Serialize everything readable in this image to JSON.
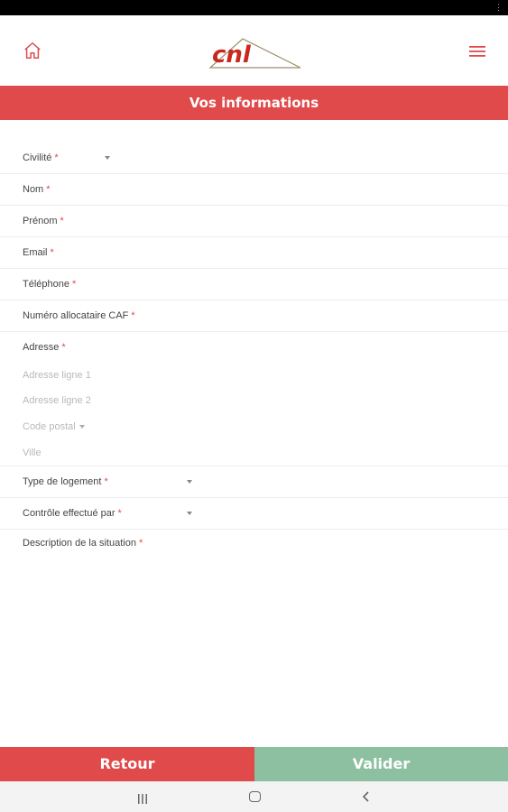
{
  "header": {
    "logo_text": "cnl"
  },
  "section_title": "Vos informations",
  "form": {
    "required_marker": "*",
    "civilite": {
      "label": "Civilité"
    },
    "nom": {
      "label": "Nom"
    },
    "prenom": {
      "label": "Prénom"
    },
    "email": {
      "label": "Email"
    },
    "telephone": {
      "label": "Téléphone"
    },
    "caf": {
      "label": "Numéro allocataire CAF"
    },
    "adresse": {
      "label": "Adresse",
      "line1_placeholder": "Adresse ligne 1",
      "line2_placeholder": "Adresse ligne 2",
      "postal_placeholder": "Code postal",
      "city_placeholder": "Ville"
    },
    "type_logement": {
      "label": "Type de logement"
    },
    "controle": {
      "label": "Contrôle effectué par"
    },
    "description": {
      "label": "Description de la situation"
    }
  },
  "buttons": {
    "back": "Retour",
    "validate": "Valider"
  },
  "colors": {
    "primary_red": "#e04a4a",
    "validate_green": "#8cc0a0"
  }
}
